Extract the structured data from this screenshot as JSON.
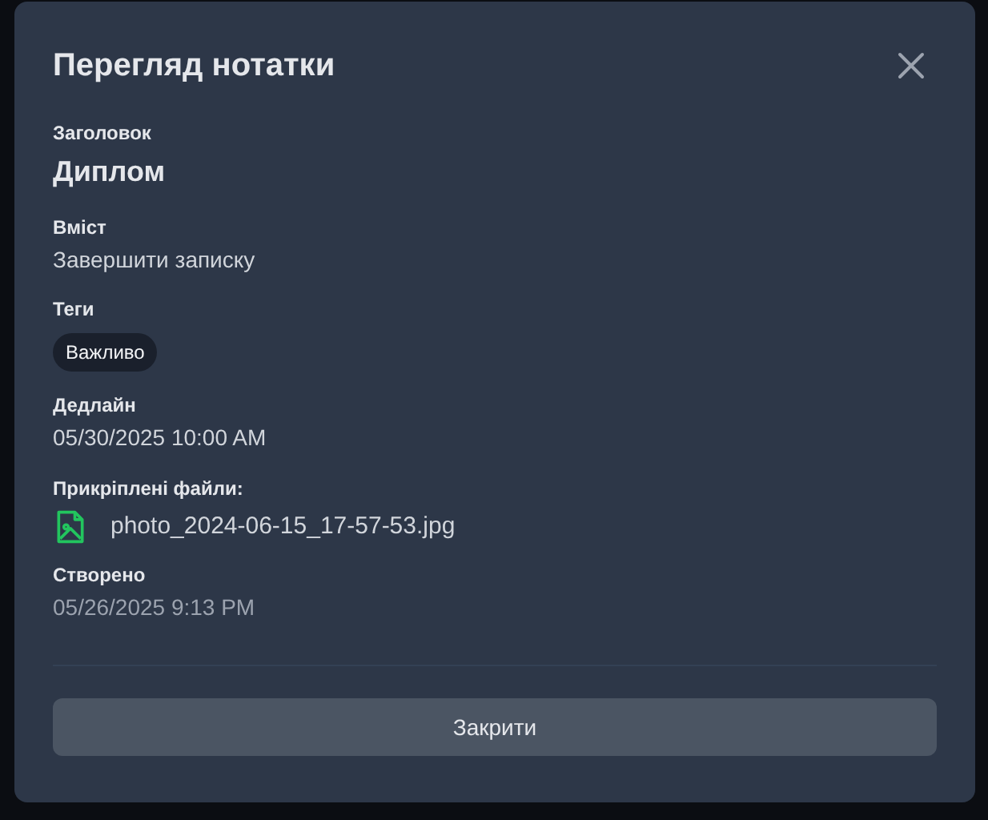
{
  "dialog": {
    "title": "Перегляд нотатки",
    "title_field": {
      "label": "Заголовок",
      "value": "Диплом"
    },
    "content": {
      "label": "Вміст",
      "value": "Завершити записку"
    },
    "tags": {
      "label": "Теги",
      "items": [
        "Важливо"
      ]
    },
    "deadline": {
      "label": "Дедлайн",
      "value": "05/30/2025 10:00 AM"
    },
    "attachments": {
      "label": "Прикріплені файли:",
      "files": [
        "photo_2024-06-15_17-57-53.jpg"
      ]
    },
    "created": {
      "label": "Створено",
      "value": "05/26/2025 9:13 PM"
    },
    "close_button": "Закрити"
  }
}
